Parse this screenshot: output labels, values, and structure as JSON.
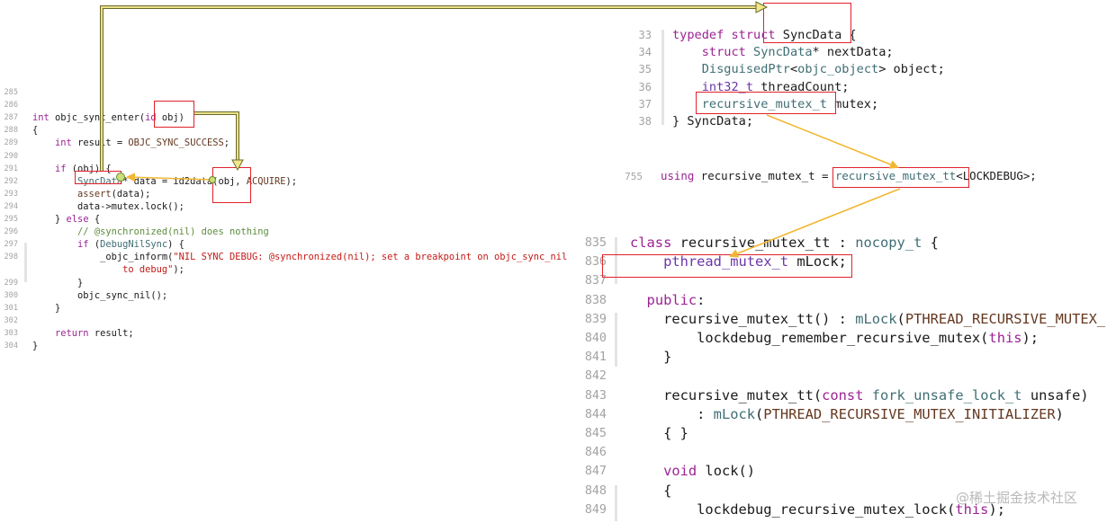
{
  "left_panel": {
    "lines": [
      {
        "n": "285",
        "code": []
      },
      {
        "n": "286",
        "code": []
      },
      {
        "n": "287",
        "code": [
          [
            "kw",
            "int"
          ],
          [
            "txt",
            " objc_sync_enter("
          ],
          [
            "kw",
            "id"
          ],
          [
            "txt",
            " obj)"
          ]
        ]
      },
      {
        "n": "288",
        "code": [
          [
            "txt",
            "{"
          ]
        ]
      },
      {
        "n": "289",
        "code": [
          [
            "txt",
            "    "
          ],
          [
            "kw",
            "int"
          ],
          [
            "txt",
            " result = "
          ],
          [
            "mac",
            "OBJC_SYNC_SUCCESS"
          ],
          [
            "txt",
            ";"
          ]
        ]
      },
      {
        "n": "290",
        "code": []
      },
      {
        "n": "291",
        "code": [
          [
            "txt",
            "    "
          ],
          [
            "kw",
            "if"
          ],
          [
            "txt",
            " (obj) {"
          ]
        ]
      },
      {
        "n": "292",
        "code": [
          [
            "txt",
            "        "
          ],
          [
            "ty",
            "SyncData"
          ],
          [
            "txt",
            "* data = id2data(obj, "
          ],
          [
            "mac",
            "ACQUIRE"
          ],
          [
            "txt",
            ");"
          ]
        ]
      },
      {
        "n": "293",
        "code": [
          [
            "txt",
            "        "
          ],
          [
            "mac",
            "assert"
          ],
          [
            "txt",
            "(data);"
          ]
        ]
      },
      {
        "n": "294",
        "code": [
          [
            "txt",
            "        data->mutex.lock();"
          ]
        ]
      },
      {
        "n": "295",
        "code": [
          [
            "txt",
            "    } "
          ],
          [
            "kw",
            "else"
          ],
          [
            "txt",
            " {"
          ]
        ]
      },
      {
        "n": "296",
        "code": [
          [
            "txt",
            "        "
          ],
          [
            "cm",
            "// @synchronized(nil) does nothing"
          ]
        ]
      },
      {
        "n": "297",
        "code": [
          [
            "txt",
            "        "
          ],
          [
            "kw",
            "if"
          ],
          [
            "txt",
            " ("
          ],
          [
            "ty",
            "DebugNilSync"
          ],
          [
            "txt",
            ") {"
          ]
        ]
      },
      {
        "n": "298",
        "code": [
          [
            "txt",
            "            _objc_inform("
          ],
          [
            "str",
            "\"NIL SYNC DEBUG: @synchronized(nil); set a breakpoint on objc_sync_nil"
          ]
        ]
      },
      {
        "n": "",
        "code": [
          [
            "str",
            "                to debug\""
          ],
          [
            "txt",
            ");"
          ]
        ]
      },
      {
        "n": "299",
        "code": [
          [
            "txt",
            "        }"
          ]
        ]
      },
      {
        "n": "300",
        "code": [
          [
            "txt",
            "        objc_sync_nil();"
          ]
        ]
      },
      {
        "n": "301",
        "code": [
          [
            "txt",
            "    }"
          ]
        ]
      },
      {
        "n": "302",
        "code": []
      },
      {
        "n": "303",
        "code": [
          [
            "txt",
            "    "
          ],
          [
            "kw",
            "return"
          ],
          [
            "txt",
            " result;"
          ]
        ]
      },
      {
        "n": "304",
        "code": [
          [
            "txt",
            "}"
          ]
        ]
      }
    ]
  },
  "top_right_panel": {
    "lines": [
      {
        "n": "33",
        "code": [
          [
            "kw",
            "typedef"
          ],
          [
            "txt",
            " "
          ],
          [
            "kw",
            "struct"
          ],
          [
            "txt",
            " SyncData {"
          ]
        ]
      },
      {
        "n": "34",
        "code": [
          [
            "txt",
            "    "
          ],
          [
            "kw",
            "struct"
          ],
          [
            "txt",
            " "
          ],
          [
            "ty",
            "SyncData"
          ],
          [
            "txt",
            "* nextData;"
          ]
        ]
      },
      {
        "n": "35",
        "code": [
          [
            "txt",
            "    "
          ],
          [
            "ty",
            "DisguisedPtr"
          ],
          [
            "txt",
            "<"
          ],
          [
            "ty",
            "objc_object"
          ],
          [
            "txt",
            "> object;"
          ]
        ]
      },
      {
        "n": "36",
        "code": [
          [
            "txt",
            "    "
          ],
          [
            "tyv",
            "int32_t"
          ],
          [
            "txt",
            " threadCount;"
          ]
        ]
      },
      {
        "n": "37",
        "code": [
          [
            "txt",
            "    "
          ],
          [
            "ty",
            "recursive_mutex_t"
          ],
          [
            "txt",
            " mutex;"
          ]
        ]
      },
      {
        "n": "38",
        "code": [
          [
            "txt",
            "} SyncData;"
          ]
        ]
      }
    ]
  },
  "using_line": {
    "n": "755",
    "code": [
      [
        "kw",
        "using"
      ],
      [
        "txt",
        " recursive_mutex_t = "
      ],
      [
        "ty",
        "recursive_mutex_tt"
      ],
      [
        "txt",
        "<LOCKDEBUG>;"
      ]
    ]
  },
  "bottom_right_panel": {
    "lines": [
      {
        "n": "835",
        "code": [
          [
            "kw",
            "class"
          ],
          [
            "txt",
            " recursive_mutex_tt : "
          ],
          [
            "ty",
            "nocopy_t"
          ],
          [
            "txt",
            " {"
          ]
        ]
      },
      {
        "n": "836",
        "code": [
          [
            "txt",
            "    "
          ],
          [
            "tyv",
            "pthread_mutex_t"
          ],
          [
            "txt",
            " mLock;"
          ]
        ]
      },
      {
        "n": "837",
        "code": []
      },
      {
        "n": "838",
        "code": [
          [
            "txt",
            "  "
          ],
          [
            "kw",
            "public"
          ],
          [
            "txt",
            ":"
          ]
        ]
      },
      {
        "n": "839",
        "code": [
          [
            "txt",
            "    recursive_mutex_tt() : "
          ],
          [
            "ty",
            "mLock"
          ],
          [
            "txt",
            "("
          ],
          [
            "mac",
            "PTHREAD_RECURSIVE_MUTEX_"
          ]
        ]
      },
      {
        "n": "840",
        "code": [
          [
            "txt",
            "        lockdebug_remember_recursive_mutex("
          ],
          [
            "kw",
            "this"
          ],
          [
            "txt",
            ");"
          ]
        ]
      },
      {
        "n": "841",
        "code": [
          [
            "txt",
            "    }"
          ]
        ]
      },
      {
        "n": "842",
        "code": []
      },
      {
        "n": "843",
        "code": [
          [
            "txt",
            "    recursive_mutex_tt("
          ],
          [
            "kw",
            "const"
          ],
          [
            "txt",
            " "
          ],
          [
            "ty",
            "fork_unsafe_lock_t"
          ],
          [
            "txt",
            " unsafe)"
          ]
        ]
      },
      {
        "n": "844",
        "code": [
          [
            "txt",
            "        : "
          ],
          [
            "ty",
            "mLock"
          ],
          [
            "txt",
            "("
          ],
          [
            "mac",
            "PTHREAD_RECURSIVE_MUTEX_INITIALIZER"
          ],
          [
            "txt",
            ")"
          ]
        ]
      },
      {
        "n": "845",
        "code": [
          [
            "txt",
            "    { }"
          ]
        ]
      },
      {
        "n": "846",
        "code": []
      },
      {
        "n": "847",
        "code": [
          [
            "txt",
            "    "
          ],
          [
            "kw",
            "void"
          ],
          [
            "txt",
            " lock()"
          ]
        ]
      },
      {
        "n": "848",
        "code": [
          [
            "txt",
            "    {"
          ]
        ]
      },
      {
        "n": "849",
        "code": [
          [
            "txt",
            "        lockdebug_recursive_mutex_lock("
          ],
          [
            "kw",
            "this"
          ],
          [
            "txt",
            ");"
          ]
        ]
      }
    ]
  },
  "watermark": "@稀土掘金技术社区",
  "colors": {
    "highlight_box": "#e0222a",
    "arrow_yellow": "#f2b632",
    "arrow_olive": "#6b6b2a"
  }
}
